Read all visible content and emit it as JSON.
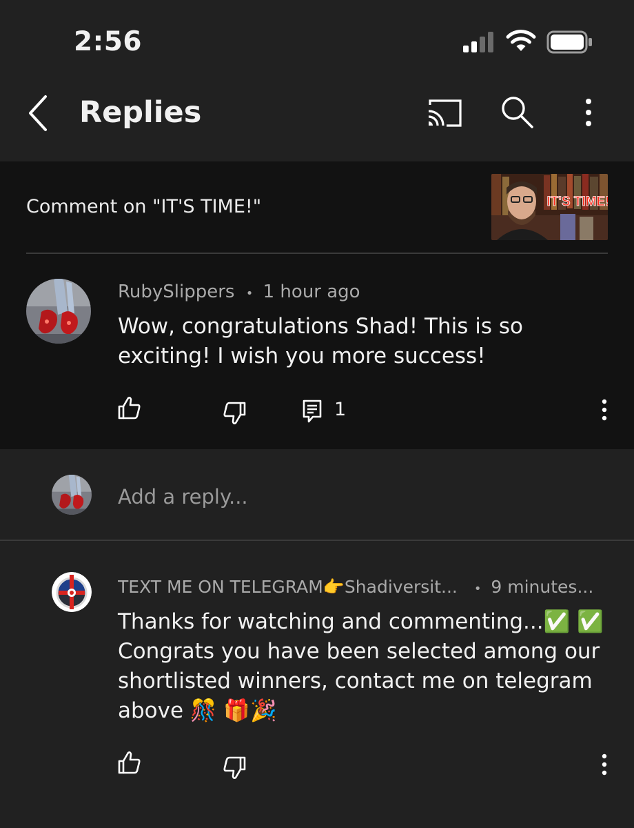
{
  "status_bar": {
    "time": "2:56",
    "icons": [
      "cellular-signal-icon",
      "wifi-icon",
      "battery-icon"
    ]
  },
  "header": {
    "title": "Replies",
    "icons": [
      "back-icon",
      "cast-icon",
      "search-icon",
      "more-vertical-icon"
    ]
  },
  "original_comment": {
    "context": "Comment on \"IT'S TIME!\"",
    "thumbnail_caption": "IT'S TIME!",
    "author": "RubySlippers",
    "separator": "•",
    "time": "1 hour ago",
    "text": "Wow, congratulations Shad! This is so exciting! I wish you more success!",
    "reply_count": "1"
  },
  "add_reply": {
    "placeholder": "Add a reply..."
  },
  "replies": [
    {
      "author": "TEXT ME ON TELEGRAM👉Shadiversit...",
      "separator": "•",
      "time": "9 minutes...",
      "text": "Thanks for watching and commenting...✅ ✅ Congrats you have been selected among our shortlisted winners, contact me on telegram above 🎊 🎁🎉"
    }
  ],
  "colors": {
    "background": "#212121",
    "panel": "#121212",
    "text": "#f1f1f1",
    "secondary_text": "#aaaaaa",
    "divider": "#3a3a3a"
  }
}
